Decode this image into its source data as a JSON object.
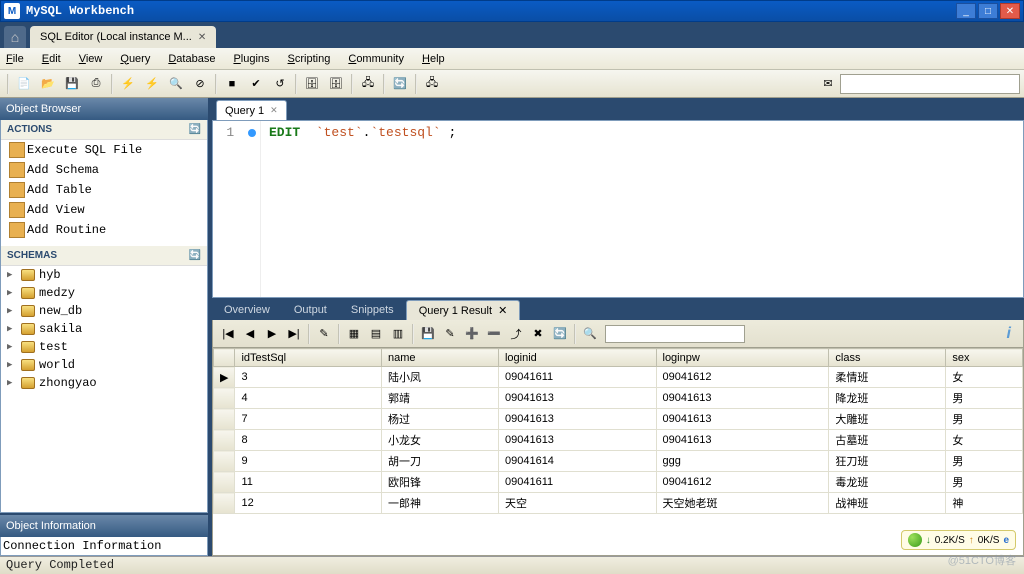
{
  "window": {
    "title": "MySQL Workbench"
  },
  "app_tab": {
    "label": "SQL Editor (Local instance M..."
  },
  "menu": {
    "file": "File",
    "edit": "Edit",
    "view": "View",
    "query": "Query",
    "database": "Database",
    "plugins": "Plugins",
    "scripting": "Scripting",
    "community": "Community",
    "help": "Help"
  },
  "sidebar": {
    "browser_title": "Object Browser",
    "actions_title": "ACTIONS",
    "actions": [
      "Execute SQL File",
      "Add Schema",
      "Add Table",
      "Add View",
      "Add Routine"
    ],
    "schemas_title": "SCHEMAS",
    "schemas": [
      "hyb",
      "medzy",
      "new_db",
      "sakila",
      "test",
      "world",
      "zhongyao"
    ],
    "object_info_title": "Object Information",
    "object_info_text": "Connection Information"
  },
  "query": {
    "tab_label": "Query 1",
    "line_no": "1",
    "code_kw": "EDIT",
    "code_s1": "`test`",
    "code_dot": ".",
    "code_s2": "`testsql`",
    "code_end": " ;"
  },
  "result_tabs": {
    "overview": "Overview",
    "output": "Output",
    "snippets": "Snippets",
    "result": "Query 1 Result"
  },
  "grid": {
    "columns": [
      "idTestSql",
      "name",
      "loginid",
      "loginpw",
      "class",
      "sex"
    ],
    "rows": [
      {
        "marker": "▶",
        "cells": [
          "3",
          "陆小凤",
          "09041611",
          "09041612",
          "柔情班",
          "女"
        ]
      },
      {
        "marker": "",
        "cells": [
          "4",
          "郭靖",
          "09041613",
          "09041613",
          "降龙班",
          "男"
        ]
      },
      {
        "marker": "",
        "cells": [
          "7",
          "杨过",
          "09041613",
          "09041613",
          "大雕班",
          "男"
        ]
      },
      {
        "marker": "",
        "cells": [
          "8",
          "小龙女",
          "09041613",
          "09041613",
          "古墓班",
          "女"
        ]
      },
      {
        "marker": "",
        "cells": [
          "9",
          "胡一刀",
          "09041614",
          "ggg",
          "狂刀班",
          "男"
        ]
      },
      {
        "marker": "",
        "cells": [
          "11",
          "欧阳锋",
          "09041611",
          "09041612",
          "毒龙班",
          "男"
        ]
      },
      {
        "marker": "",
        "cells": [
          "12",
          "一郎神",
          "天空",
          "天空她老斑",
          "战神班",
          "神"
        ]
      }
    ]
  },
  "netspeed": {
    "down": "0.2K/S",
    "up": "0K/S"
  },
  "status": {
    "text": "Query Completed"
  },
  "watermark": "@51CTO博客",
  "icons": {
    "new": "📄",
    "open": "📂",
    "save": "💾",
    "saveall": "⎙",
    "bolt": "⚡",
    "boltplay": "⚡",
    "zoom": "🔍",
    "zoomcancel": "⊘",
    "stop": "■",
    "commit": "✔",
    "rollback": "↺",
    "db1": "🗄",
    "db2": "🗄",
    "sync": "🔄",
    "conn": "🖧",
    "mailstar": "✉",
    "first": "|◀",
    "prev": "◀",
    "next": "▶",
    "last": "▶|",
    "edit": "✎",
    "gridmode": "▦",
    "grid2": "▤",
    "grid3": "▥",
    "apply": "💾",
    "pencil": "✎",
    "add": "➕",
    "remove": "➖",
    "export": "⤴",
    "delete": "✖",
    "refresh": "🔄",
    "find": "🔍",
    "ie": "e"
  }
}
